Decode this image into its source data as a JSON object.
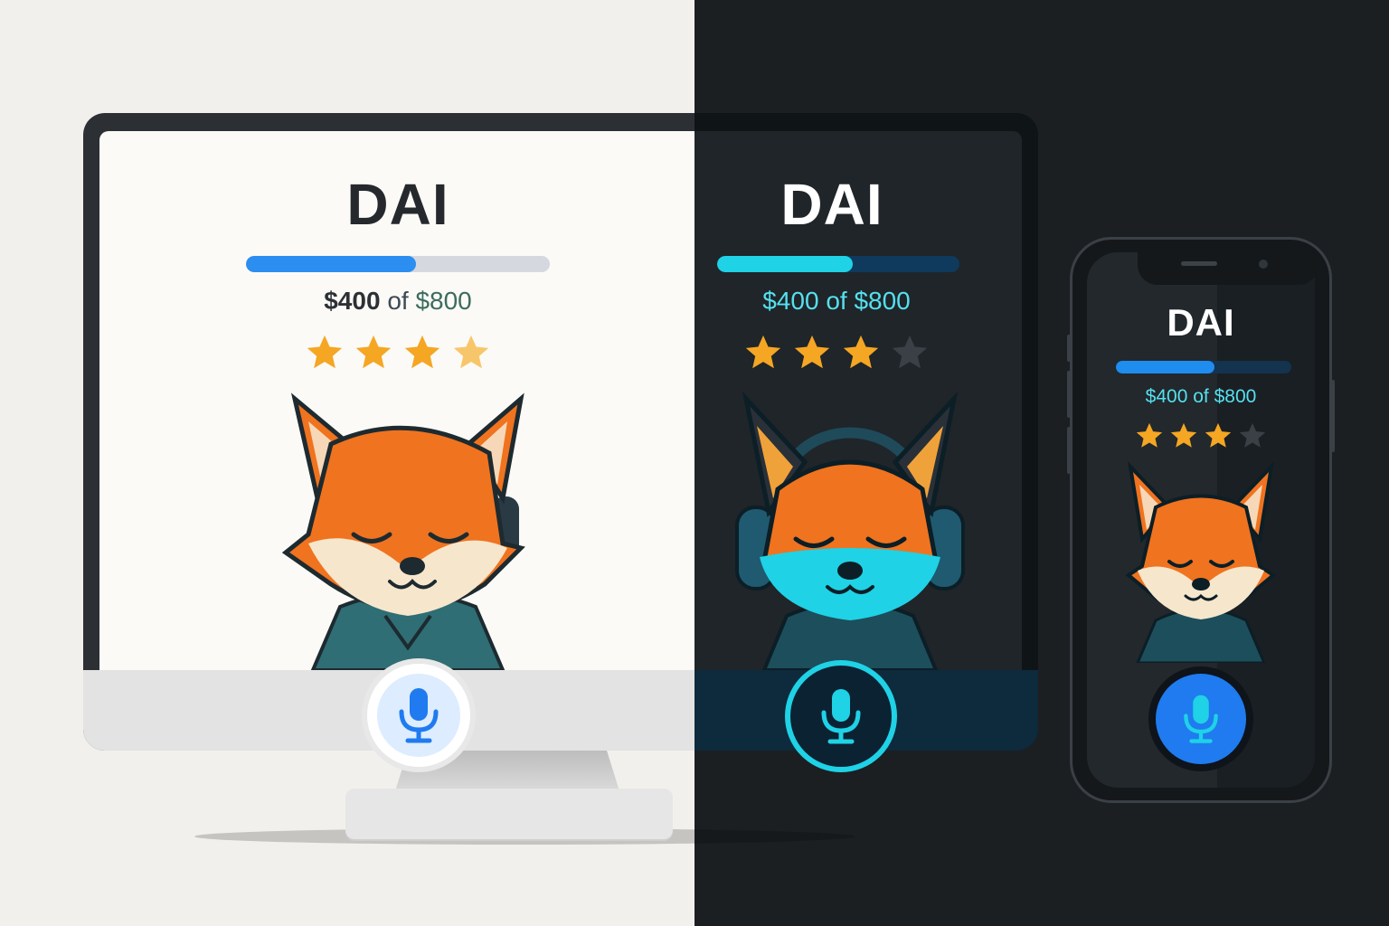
{
  "colors": {
    "light_bg": "#f2f0ec",
    "dark_bg": "#1b1f22",
    "progress_blue": "#2b8ef0",
    "progress_cyan": "#1fd2e6",
    "star_gold": "#f5a623",
    "star_empty": "#3a4046",
    "mic_blue": "#1f7bef",
    "mic_cyan": "#1fd2e6"
  },
  "light_panel": {
    "title": "DAI",
    "amount_raised": "$400",
    "amount_of": "of",
    "amount_goal": "$800",
    "progress": 0.5,
    "rating": 4,
    "max_rating": 4,
    "avatar": "fox-with-headphones-avatar",
    "mic_icon": "microphone-icon"
  },
  "dark_panel": {
    "title": "DAI",
    "amount_raised": "$400",
    "amount_of": "of",
    "amount_goal": "$800",
    "progress": 0.5,
    "rating": 3,
    "max_rating": 4,
    "avatar": "fox-with-headphones-avatar",
    "mic_icon": "microphone-icon"
  },
  "phone_panel": {
    "title": "DAI",
    "amount_raised": "$400",
    "amount_of": "of",
    "amount_goal": "$800",
    "progress": 0.5,
    "rating": 3,
    "max_rating": 4,
    "avatar": "fox-avatar",
    "mic_icon": "microphone-icon"
  }
}
